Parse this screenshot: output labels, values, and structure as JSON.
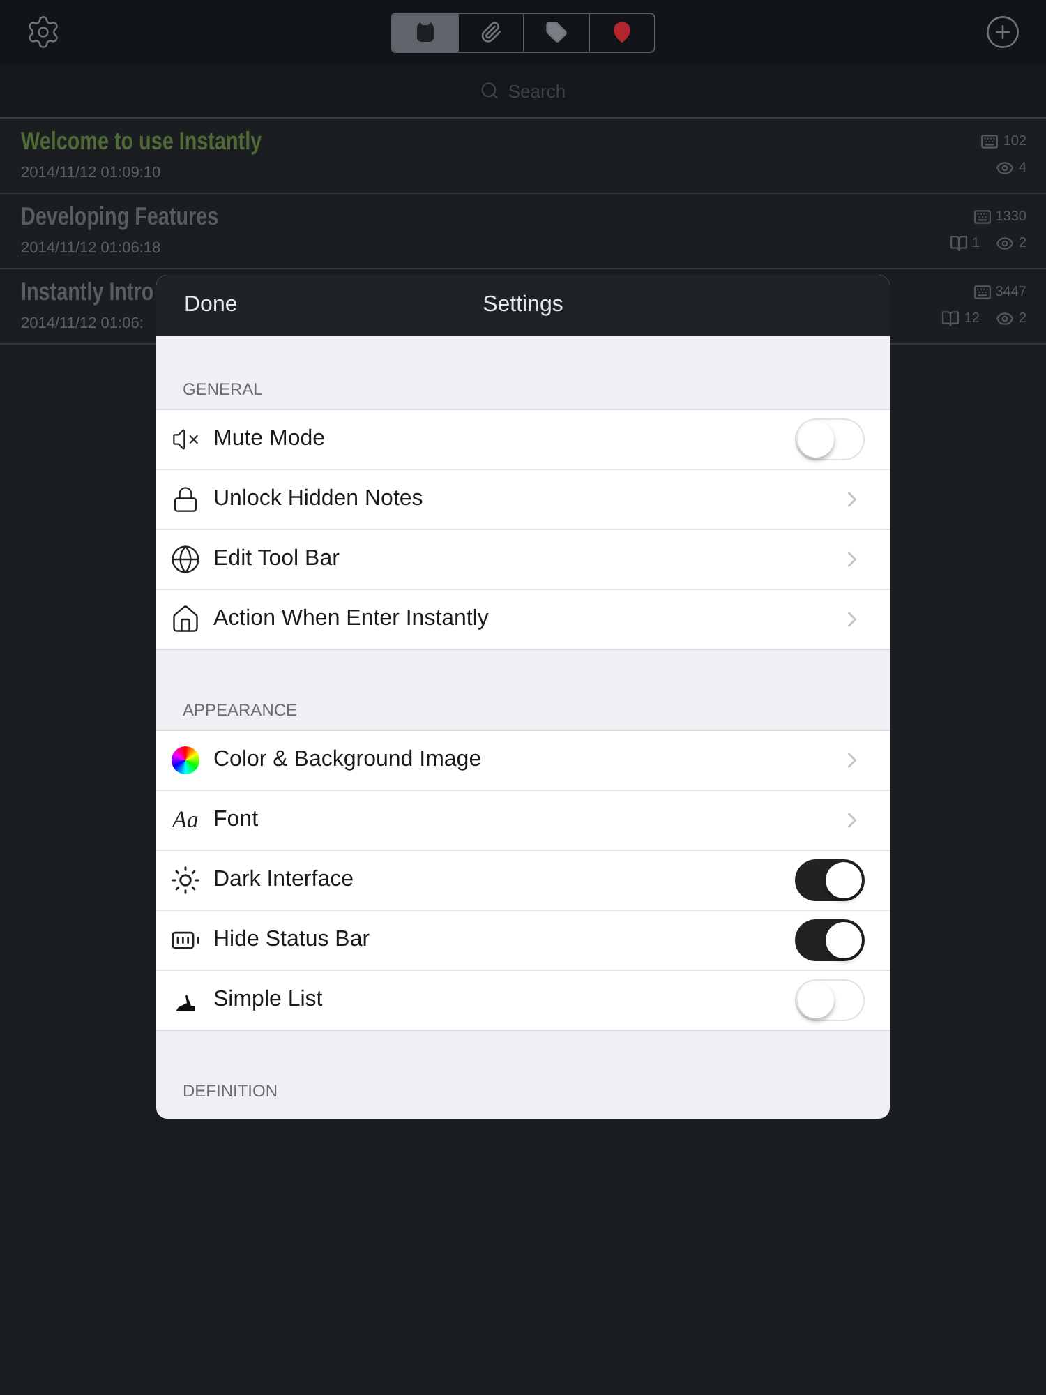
{
  "toolbar": {
    "segments": [
      {
        "selected": true
      },
      {
        "selected": false
      },
      {
        "selected": false
      },
      {
        "selected": false
      }
    ]
  },
  "search": {
    "placeholder": "Search"
  },
  "notes": [
    {
      "title": "Welcome to use Instantly",
      "highlighted": true,
      "date": "2014/11/12 01:09:10",
      "chars": "102",
      "views": "4"
    },
    {
      "title": "Developing Features",
      "highlighted": false,
      "date": "2014/11/12 01:06:18",
      "chars": "1330",
      "pages": "1",
      "views": "2"
    },
    {
      "title": "Instantly Intro",
      "highlighted": false,
      "date": "2014/11/12 01:06:",
      "chars": "3447",
      "pages": "12",
      "views": "2"
    }
  ],
  "settings": {
    "done": "Done",
    "title": "Settings",
    "sections": [
      {
        "header": "GENERAL",
        "items": [
          {
            "label": "Mute Mode",
            "kind": "toggle",
            "on": false
          },
          {
            "label": "Unlock Hidden Notes",
            "kind": "link"
          },
          {
            "label": "Edit Tool Bar",
            "kind": "link"
          },
          {
            "label": "Action When Enter Instantly",
            "kind": "link"
          }
        ]
      },
      {
        "header": "APPEARANCE",
        "items": [
          {
            "label": "Color & Background Image",
            "kind": "link"
          },
          {
            "label": "Font",
            "kind": "link",
            "icon_text": "Aa"
          },
          {
            "label": "Dark Interface",
            "kind": "toggle",
            "on": true
          },
          {
            "label": "Hide Status Bar",
            "kind": "toggle",
            "on": true
          },
          {
            "label": "Simple List",
            "kind": "toggle",
            "on": false
          }
        ]
      },
      {
        "header": "DEFINITION"
      }
    ]
  }
}
